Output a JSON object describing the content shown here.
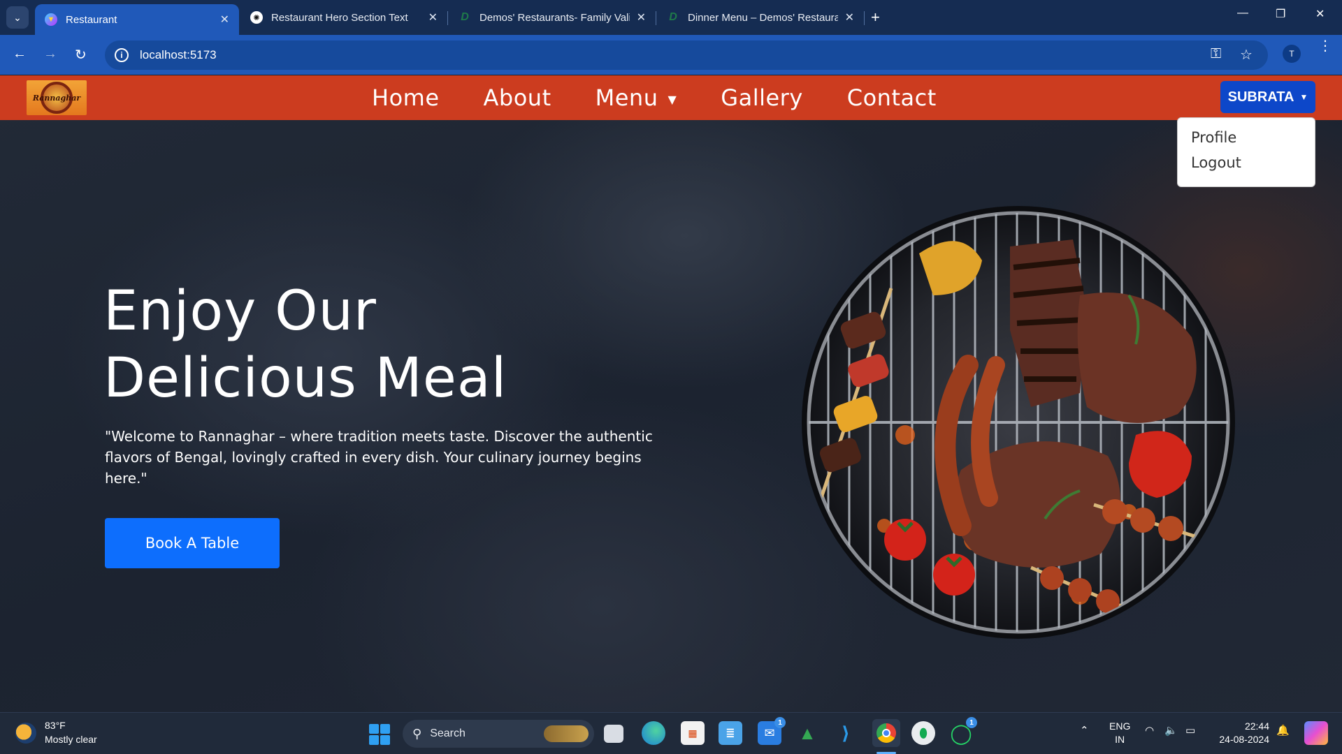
{
  "browser": {
    "tabs": [
      {
        "title": "Restaurant",
        "active": true,
        "favicon": "vite-icon"
      },
      {
        "title": "Restaurant Hero Section Text",
        "active": false,
        "favicon": "chatgpt-icon"
      },
      {
        "title": "Demos' Restaurants- Family Vali",
        "active": false,
        "favicon": "site-icon"
      },
      {
        "title": "Dinner Menu – Demos' Restaura",
        "active": false,
        "favicon": "site-icon"
      }
    ],
    "new_tab": "+",
    "url": "localhost:5173",
    "profile_initial": "T"
  },
  "navbar": {
    "logo_text": "Rannaghar",
    "links": [
      "Home",
      "About",
      "Menu",
      "Gallery",
      "Contact"
    ],
    "user_name": "SUBRATA",
    "dropdown_items": [
      "Profile",
      "Logout"
    ]
  },
  "hero": {
    "title_line1": "Enjoy Our",
    "title_line2": "Delicious Meal",
    "text": "\"Welcome to Rannaghar – where tradition meets taste. Discover the authentic flavors of Bengal, lovingly crafted in every dish. Your culinary journey begins here.\"",
    "button": "Book A Table"
  },
  "taskbar": {
    "weather_temp": "83°F",
    "weather_desc": "Mostly clear",
    "search_placeholder": "Search",
    "lang_top": "ENG",
    "lang_bottom": "IN",
    "time": "22:44",
    "date": "24-08-2024",
    "mail_badge": "1",
    "whatsapp_badge": "1"
  },
  "colors": {
    "navbar": "#cc3c1f",
    "user_button": "#0d47c9",
    "book_button": "#0d6efd",
    "browser_toolbar": "#2059b9",
    "tabstrip": "#152c52"
  }
}
